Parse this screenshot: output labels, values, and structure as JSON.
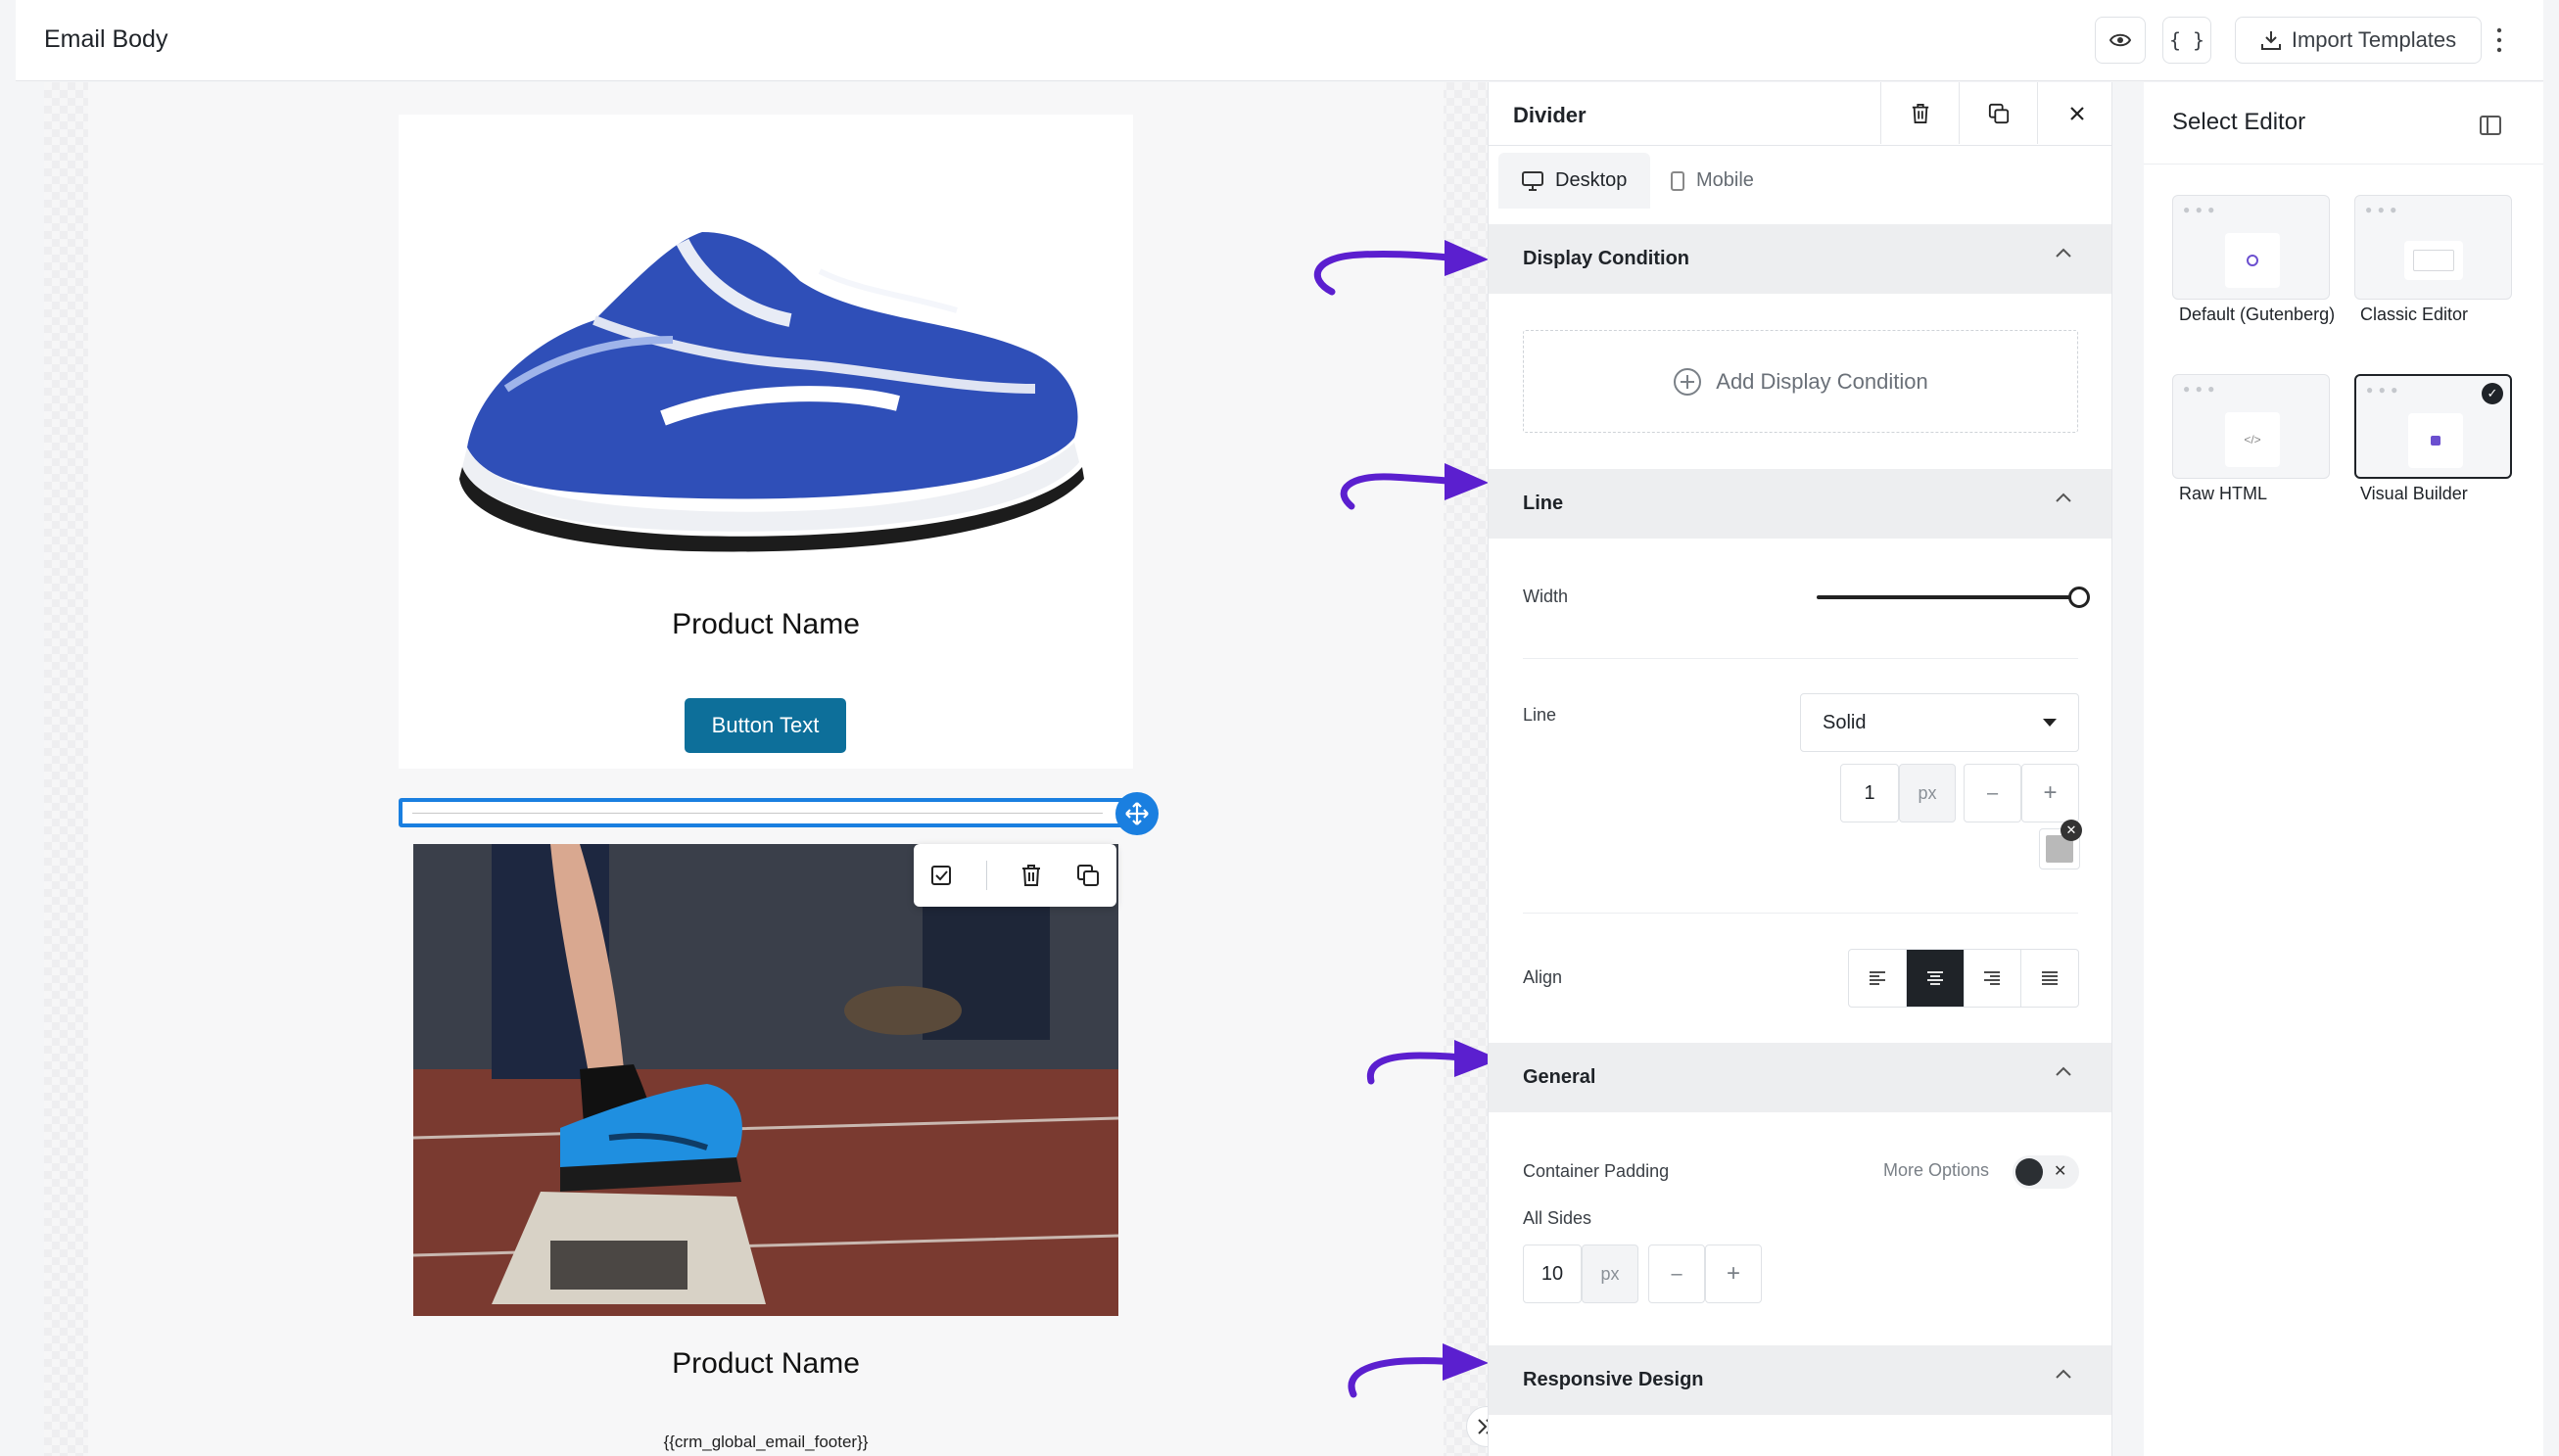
{
  "header": {
    "title": "Email Body",
    "import_label": "Import Templates"
  },
  "canvas": {
    "product_name_1": "Product Name",
    "button_text": "Button Text",
    "product_name_2": "Product Name",
    "footer_tag": "{{crm_global_email_footer}}"
  },
  "panel": {
    "title": "Divider",
    "tabs": [
      "Desktop",
      "Mobile"
    ],
    "sections": {
      "display_condition": "Display Condition",
      "line": "Line",
      "general": "General",
      "responsive": "Responsive Design"
    },
    "add_condition": "Add Display Condition",
    "width_label": "Width",
    "width_value": 1.0,
    "line_label": "Line",
    "line_style": "Solid",
    "line_size": "1",
    "line_unit": "px",
    "align_label": "Align",
    "align_selected": "center",
    "padding_label": "Container Padding",
    "more_options": "More Options",
    "all_sides": "All Sides",
    "padding_value": "10",
    "padding_unit": "px",
    "line_color": "#b9b9b9"
  },
  "editor": {
    "title": "Select Editor",
    "options": [
      {
        "label": "Default (Gutenberg)",
        "selected": false
      },
      {
        "label": "Classic Editor",
        "selected": false
      },
      {
        "label": "Raw HTML",
        "selected": false
      },
      {
        "label": "Visual Builder",
        "selected": true
      }
    ]
  },
  "colors": {
    "accent": "#1a7fe0",
    "button": "#0d6f9a",
    "annotation": "#5b1fcf"
  }
}
